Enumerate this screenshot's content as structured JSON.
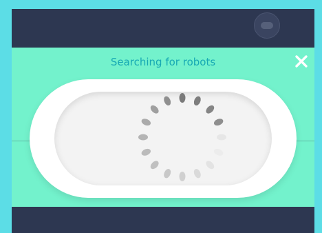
{
  "modal": {
    "title": "Searching for robots",
    "close_icon": "close-icon"
  },
  "header": {
    "avatar_icon": "robot-avatar-icon"
  },
  "spinner": {
    "icon": "loading-spinner-icon",
    "dot_count": 16
  },
  "colors": {
    "page_background": "#5cdde6",
    "app_background": "#2d3751",
    "modal_background": "#73f2cc",
    "title_color": "#17a9b4",
    "pill_background": "#ffffff"
  }
}
